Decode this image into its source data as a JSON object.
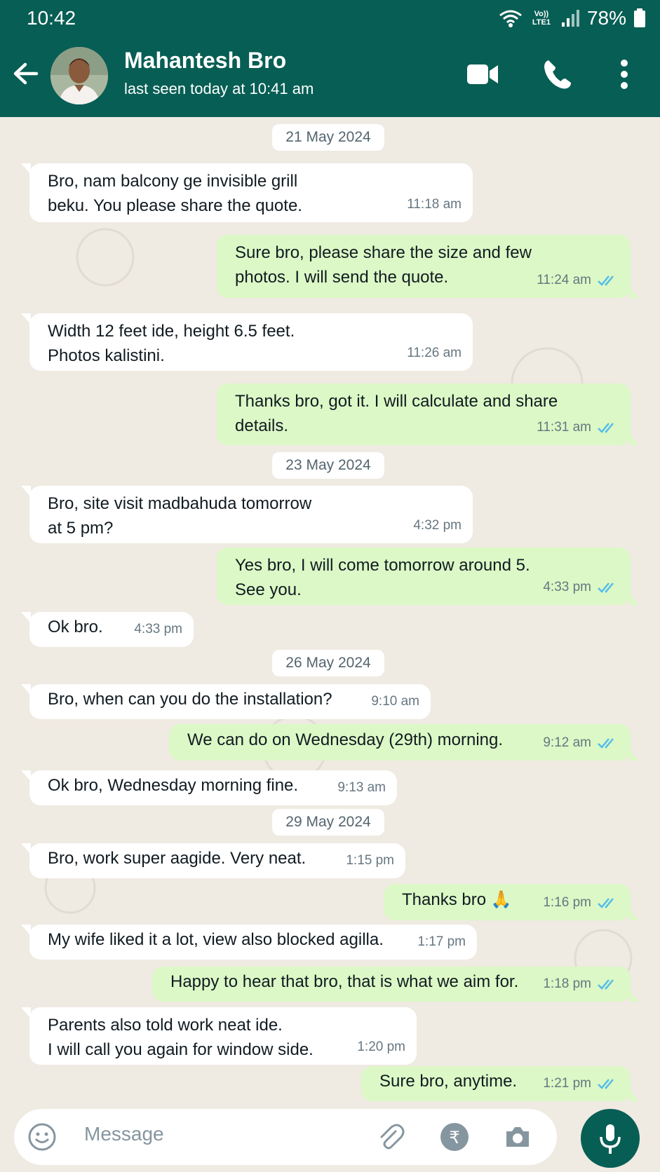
{
  "status_bar": {
    "time": "10:42",
    "lte_label": "Vo)) LTE1",
    "battery": "78%"
  },
  "header": {
    "contact_name": "Mahantesh Bro",
    "status": "last seen today at 10:41 am"
  },
  "messages": [
    {
      "type": "date",
      "text": "21 May 2024"
    },
    {
      "type": "in",
      "text": "Bro, nam balcony ge invisible grill\nbeku. You please share the quote.",
      "time": "11:18 am"
    },
    {
      "type": "out",
      "text": "Sure bro, please share the size and few\nphotos. I will send the quote.",
      "time": "11:24 am"
    },
    {
      "type": "in",
      "text": "Width 12 feet ide, height 6.5 feet.\nPhotos kalistini.",
      "time": "11:26 am"
    },
    {
      "type": "out",
      "text": "Thanks bro, got it. I will calculate and share\ndetails.",
      "time": "11:31 am"
    },
    {
      "type": "date",
      "text": "23 May 2024"
    },
    {
      "type": "in",
      "text": "Bro, site visit madbahuda tomorrow\nat 5 pm?",
      "time": "4:32 pm"
    },
    {
      "type": "out",
      "text": "Yes bro, I will come tomorrow around 5.\nSee you.",
      "time": "4:33 pm"
    },
    {
      "type": "in",
      "text": "Ok bro.",
      "time": "4:33 pm"
    },
    {
      "type": "date",
      "text": "26 May 2024"
    },
    {
      "type": "in",
      "text": "Bro, when can you do the installation?",
      "time": "9:10 am"
    },
    {
      "type": "out",
      "text": "We can do on Wednesday (29th) morning.",
      "time": "9:12 am"
    },
    {
      "type": "in",
      "text": "Ok bro, Wednesday morning fine.",
      "time": "9:13 am"
    },
    {
      "type": "date",
      "text": "29 May 2024"
    },
    {
      "type": "in",
      "text": "Bro, work super aagide. Very neat.",
      "time": "1:15 pm"
    },
    {
      "type": "out",
      "text": "Thanks bro 🙏",
      "time": "1:16 pm"
    },
    {
      "type": "in",
      "text": "My wife liked it a lot, view also blocked agilla.",
      "time": "1:17 pm"
    },
    {
      "type": "out",
      "text": "Happy to hear that bro, that is what we aim for.",
      "time": "1:18 pm"
    },
    {
      "type": "in",
      "text": "Parents also told work neat ide.\nI will call you again for window side.",
      "time": "1:20 pm"
    },
    {
      "type": "out",
      "text": "Sure bro, anytime.",
      "time": "1:21 pm"
    }
  ],
  "composer": {
    "placeholder": "Message"
  },
  "colors": {
    "header": "#075e54",
    "outgoing_bubble": "#dcf8c6",
    "incoming_bubble": "#ffffff",
    "read_ticks": "#53bdeb",
    "background": "#efeae2"
  }
}
